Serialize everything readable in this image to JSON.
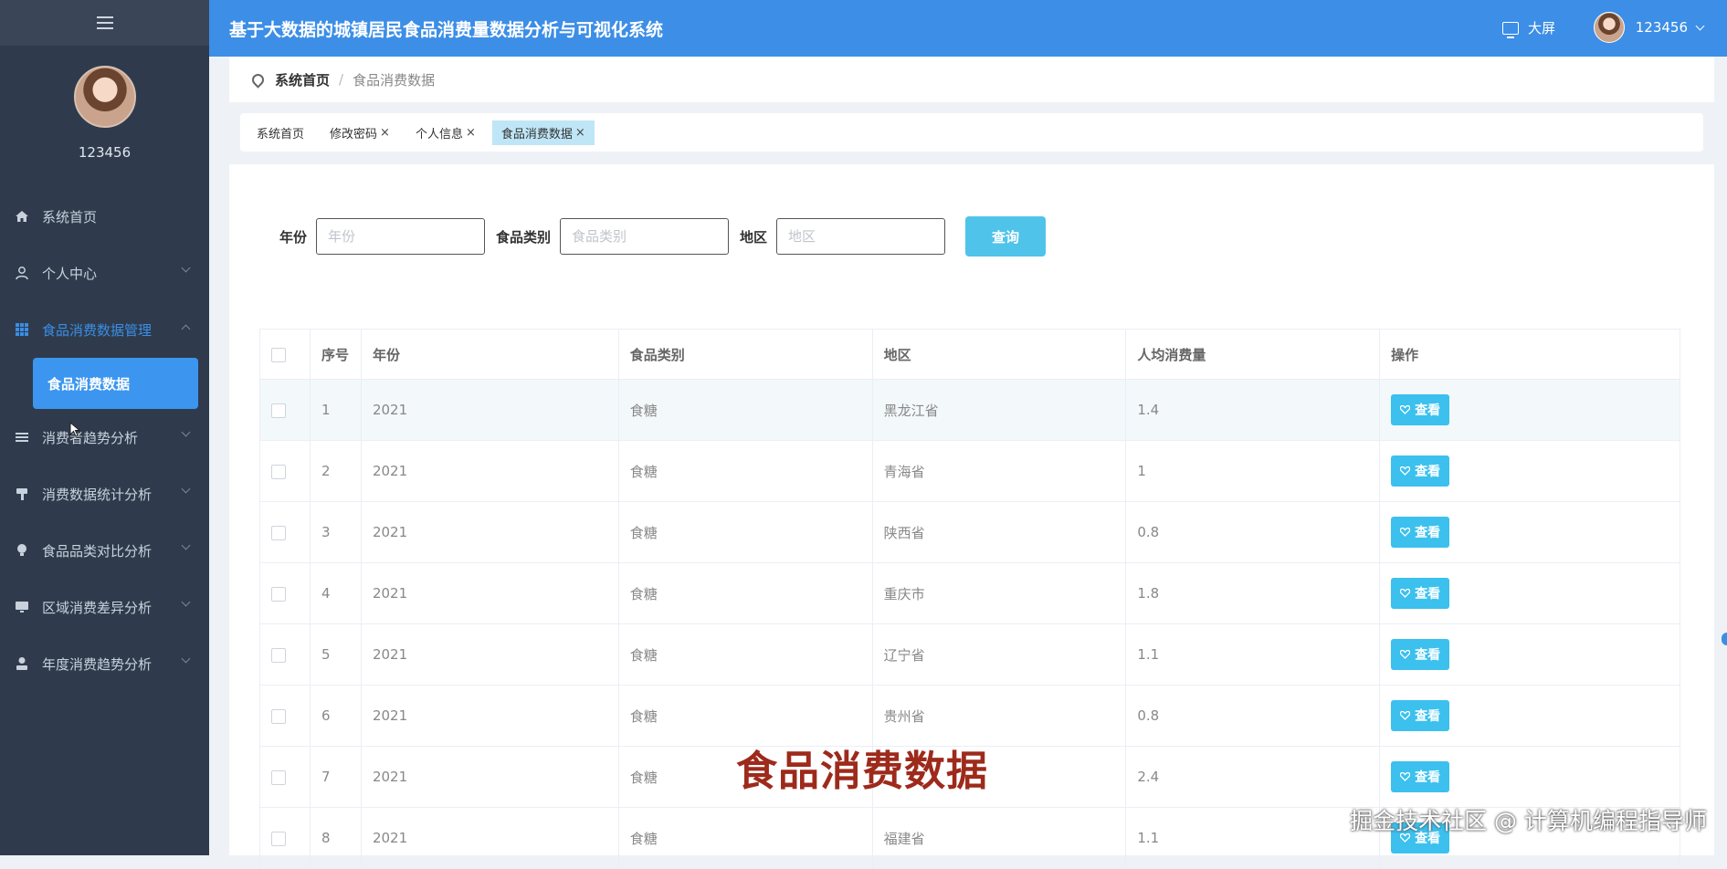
{
  "app": {
    "title": "基于大数据的城镇居民食品消费量数据分析与可视化系统"
  },
  "header": {
    "big_screen": "大屏",
    "username": "123456"
  },
  "sidebar": {
    "username": "123456",
    "menu": [
      {
        "label": "系统首页",
        "icon": "home-icon"
      },
      {
        "label": "个人中心",
        "icon": "user-icon"
      },
      {
        "label": "食品消费数据管理",
        "icon": "grid-icon"
      },
      {
        "label": "消费者趋势分析",
        "icon": "list-icon"
      },
      {
        "label": "消费数据统计分析",
        "icon": "hammer-icon"
      },
      {
        "label": "食品品类对比分析",
        "icon": "bulb-icon"
      },
      {
        "label": "区域消费差异分析",
        "icon": "monitor-icon"
      },
      {
        "label": "年度消费趋势分析",
        "icon": "person-icon"
      }
    ],
    "submenu": {
      "label": "食品消费数据"
    }
  },
  "breadcrumb": {
    "home": "系统首页",
    "separator": "/",
    "current": "食品消费数据"
  },
  "tags": [
    {
      "label": "系统首页"
    },
    {
      "label": "修改密码",
      "close": "×"
    },
    {
      "label": "个人信息",
      "close": "×"
    },
    {
      "label": "食品消费数据",
      "close": "×"
    }
  ],
  "search": {
    "year_label": "年份",
    "year_placeholder": "年份",
    "category_label": "食品类别",
    "category_placeholder": "食品类别",
    "region_label": "地区",
    "region_placeholder": "地区",
    "button": "查询"
  },
  "table": {
    "headers": [
      "序号",
      "年份",
      "食品类别",
      "地区",
      "人均消费量",
      "操作"
    ],
    "view_label": "查看",
    "rows": [
      [
        "1",
        "2021",
        "食糖",
        "黑龙江省",
        "1.4"
      ],
      [
        "2",
        "2021",
        "食糖",
        "青海省",
        "1"
      ],
      [
        "3",
        "2021",
        "食糖",
        "陕西省",
        "0.8"
      ],
      [
        "4",
        "2021",
        "食糖",
        "重庆市",
        "1.8"
      ],
      [
        "5",
        "2021",
        "食糖",
        "辽宁省",
        "1.1"
      ],
      [
        "6",
        "2021",
        "食糖",
        "贵州省",
        "0.8"
      ],
      [
        "7",
        "2021",
        "食糖",
        "",
        "2.4"
      ],
      [
        "8",
        "2021",
        "食糖",
        "福建省",
        "1.1"
      ]
    ]
  },
  "overlay": {
    "caption": "食品消费数据",
    "watermark": "掘金技术社区 @ 计算机编程指导师"
  },
  "colors": {
    "header": "#3c8ee6",
    "sidebar": "#2f3b4c",
    "accent": "#3c96ef",
    "view_button": "#3cc0ee",
    "caption": "#9d2a1b"
  }
}
